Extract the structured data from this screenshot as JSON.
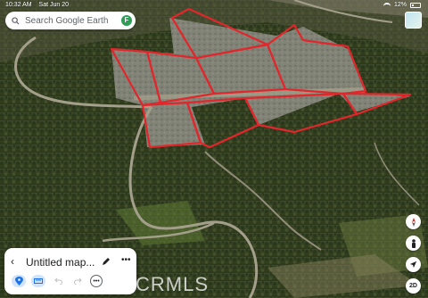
{
  "status_bar": {
    "time": "10:32 AM",
    "date": "Sat Jun 20",
    "battery": "12%"
  },
  "search": {
    "placeholder": "Search Google Earth"
  },
  "account": {
    "initial": "F"
  },
  "project": {
    "title": "Untitled map..."
  },
  "controls": {
    "view_mode": "2D"
  },
  "watermark": {
    "text": "CRMLS"
  },
  "colors": {
    "boundary": "#e3262b",
    "accent": "#1a73e8",
    "avatar": "#2e9e57"
  },
  "icons": [
    "search-icon",
    "globe-icon",
    "compass-icon",
    "pegman-icon",
    "my-location-icon",
    "back-icon",
    "edit-icon",
    "more-icon",
    "add-placemark-icon",
    "measure-icon",
    "undo-icon",
    "redo-icon"
  ]
}
